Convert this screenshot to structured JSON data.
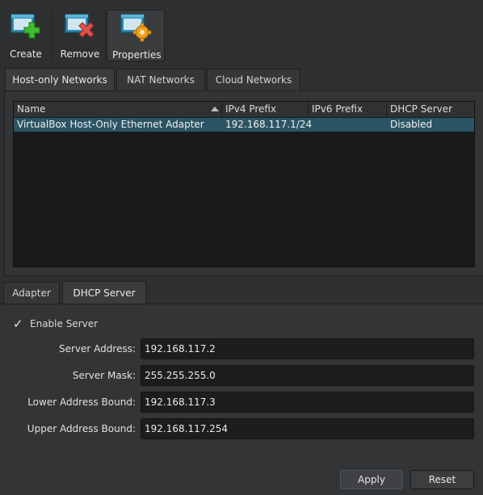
{
  "toolbar": {
    "create_label": "Create",
    "remove_label": "Remove",
    "properties_label": "Properties"
  },
  "top_tabs": [
    {
      "label": "Host-only Networks",
      "selected": true
    },
    {
      "label": "NAT Networks",
      "selected": false
    },
    {
      "label": "Cloud Networks",
      "selected": false
    }
  ],
  "table": {
    "columns": [
      "Name",
      "IPv4 Prefix",
      "IPv6 Prefix",
      "DHCP Server"
    ],
    "rows": [
      [
        "VirtualBox Host-Only Ethernet Adapter",
        "192.168.117.1/24",
        "",
        "Disabled"
      ]
    ]
  },
  "bottom_tabs": [
    {
      "label": "Adapter",
      "selected": false
    },
    {
      "label": "DHCP Server",
      "selected": true
    }
  ],
  "dhcp": {
    "enable_label": "Enable Server",
    "enabled": true,
    "fields": [
      {
        "label": "Server Address:",
        "value": "192.168.117.2"
      },
      {
        "label": "Server Mask:",
        "value": "255.255.255.0"
      },
      {
        "label": "Lower Address Bound:",
        "value": "192.168.117.3"
      },
      {
        "label": "Upper Address Bound:",
        "value": "192.168.117.254"
      }
    ]
  },
  "buttons": {
    "apply_label": "Apply",
    "reset_label": "Reset"
  },
  "colors": {
    "background": "#2e2f30",
    "selection": "#2b5464",
    "create_accent": "#3dbd2e",
    "remove_accent": "#e2504a",
    "properties_accent": "#f0a21c"
  }
}
